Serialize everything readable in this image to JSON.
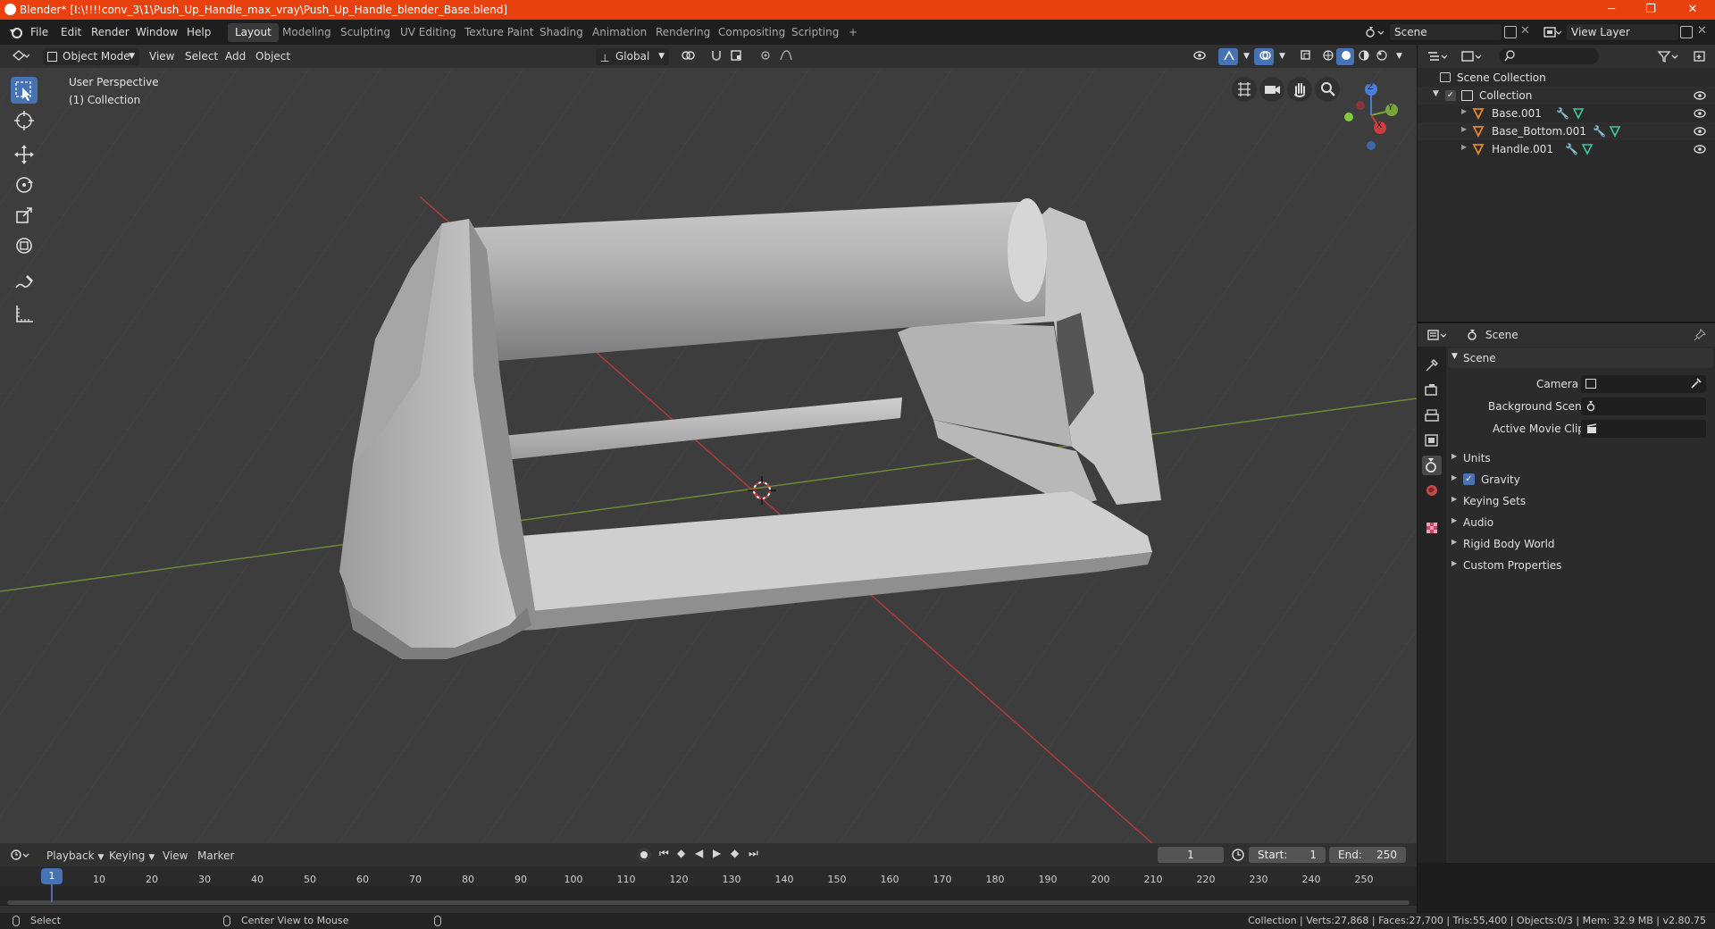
{
  "window": {
    "title": "Blender* [I:\\!!!!conv_3\\1\\Push_Up_Handle_max_vray\\Push_Up_Handle_blender_Base.blend]",
    "minimize": "─",
    "restore": "❐",
    "close": "✕"
  },
  "menu": {
    "items": [
      "File",
      "Edit",
      "Render",
      "Window",
      "Help"
    ]
  },
  "workspaces": [
    "Layout",
    "Modeling",
    "Sculpting",
    "UV Editing",
    "Texture Paint",
    "Shading",
    "Animation",
    "Rendering",
    "Compositing",
    "Scripting",
    "+"
  ],
  "scene": {
    "name": "Scene",
    "view_layer": "View Layer"
  },
  "viewport_header": {
    "mode": "Object Mode",
    "menus": [
      "View",
      "Select",
      "Add",
      "Object"
    ],
    "transform_orientation": "Global"
  },
  "viewport": {
    "view_name": "User Perspective",
    "collection_label": "(1) Collection",
    "axes": {
      "x": "X",
      "y": "Y",
      "z": "Z"
    }
  },
  "outliner": {
    "root": "Scene Collection",
    "collection": "Collection",
    "objects": [
      "Base.001",
      "Base_Bottom.001",
      "Handle.001"
    ]
  },
  "properties": {
    "context": "Scene",
    "panel_title": "Scene",
    "camera_label": "Camera",
    "background_scene_label": "Background Scene",
    "movie_clip_label": "Active Movie Clip",
    "subpanels": [
      "Units",
      "Gravity",
      "Keying Sets",
      "Audio",
      "Rigid Body World",
      "Custom Properties"
    ],
    "gravity_checked": true
  },
  "timeline": {
    "menus": [
      "Playback",
      "Keying",
      "View",
      "Marker"
    ],
    "current_frame": "1",
    "start_label": "Start:",
    "start": "1",
    "end_label": "End:",
    "end": "250",
    "ticks": [
      "1",
      "10",
      "20",
      "30",
      "40",
      "50",
      "60",
      "70",
      "80",
      "90",
      "100",
      "110",
      "120",
      "130",
      "140",
      "150",
      "160",
      "170",
      "180",
      "190",
      "200",
      "210",
      "220",
      "230",
      "240",
      "250"
    ]
  },
  "status": {
    "left_action": "Select",
    "middle_action": "Center View to Mouse",
    "stats": "Collection | Verts:27,868 | Faces:27,700 | Tris:55,400 | Objects:0/3 | Mem: 32.9 MB | v2.80.75"
  },
  "colors": {
    "titlebar": "#e8410e",
    "accent": "#4772b3",
    "viewport_bg": "#3d3d3d",
    "x_axis": "#c83c3c",
    "y_axis": "#7aa53a",
    "mesh_icon": "#e58a2c"
  }
}
